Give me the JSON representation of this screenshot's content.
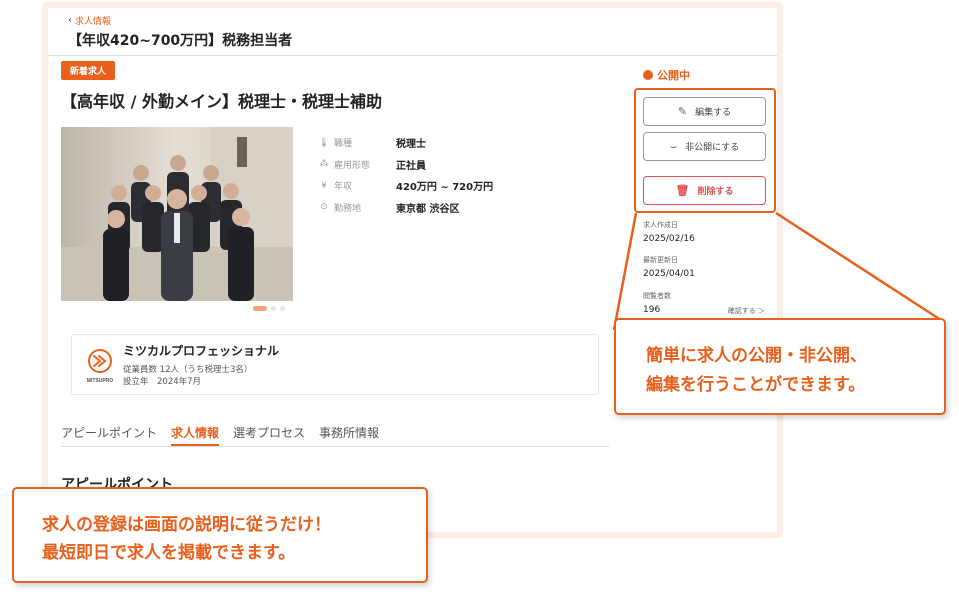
{
  "header": {
    "back_label": "求人情報",
    "page_title": "【年収420~700万円】税務担当者"
  },
  "job": {
    "badge": "新着求人",
    "title": "【高年収 / 外勤メイン】税理士・税理士補助",
    "details": [
      {
        "icon": "thermometer-icon",
        "label": "職種",
        "value": "税理士"
      },
      {
        "icon": "org-icon",
        "label": "雇用形態",
        "value": "正社員"
      },
      {
        "icon": "yen-icon",
        "label": "年収",
        "value": "420万円 ~ 720万円"
      },
      {
        "icon": "location-icon",
        "label": "勤務地",
        "value": "東京都 渋谷区"
      }
    ]
  },
  "company": {
    "name": "ミツカルプロフェッショナル",
    "logo_text": "MITSUPRO",
    "employees": "従業員数 12人（うち税理士3名）",
    "founded": "設立年　2024年7月"
  },
  "tabs": [
    "アピールポイント",
    "求人情報",
    "選考プロセス",
    "事務所情報"
  ],
  "active_tab": 1,
  "section_title": "アピールポイント",
  "sidebar": {
    "status": "公開中",
    "edit_label": "編集する",
    "unpublish_label": "非公開にする",
    "delete_label": "削除する",
    "created_label": "求人作成日",
    "created_value": "2025/02/16",
    "updated_label": "最新更新日",
    "updated_value": "2025/04/01",
    "views_label": "閲覧者数",
    "views_value": "196",
    "confirm_label": "確認する ＞"
  },
  "callouts": {
    "right_line1": "簡単に求人の公開・非公開、",
    "right_line2": "編集を行うことができます。",
    "left_line1": "求人の登録は画面の説明に従うだけ！",
    "left_line2": "最短即日で求人を掲載できます。"
  },
  "colors": {
    "accent": "#e8601c",
    "danger": "#e05050",
    "frame": "#fdeee8"
  }
}
